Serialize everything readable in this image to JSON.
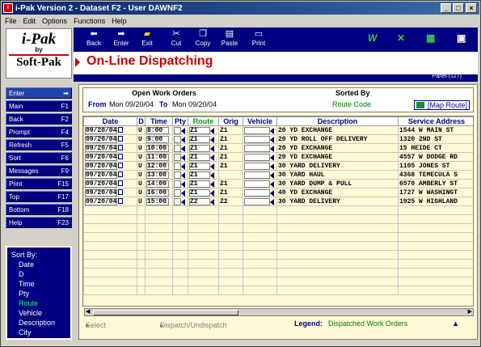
{
  "window": {
    "title": "i-Pak Version 2 - Dataset F2 - User DAWNF2"
  },
  "menu": [
    "File",
    "Edit",
    "Options",
    "Functions",
    "Help"
  ],
  "logo": {
    "brand": "i-Pak",
    "by": "by",
    "company": "Soft-Pak"
  },
  "toolbar": {
    "buttons": [
      {
        "label": "Back",
        "icon": "back-arrow-icon"
      },
      {
        "label": "Enter",
        "icon": "enter-arrow-icon"
      },
      {
        "label": "Exit",
        "icon": "exit-folder-icon"
      },
      {
        "label": "Cut",
        "icon": "scissors-icon"
      },
      {
        "label": "Copy",
        "icon": "copy-icon"
      },
      {
        "label": "Paste",
        "icon": "paste-icon"
      },
      {
        "label": "Print",
        "icon": "printer-icon"
      }
    ],
    "right_icons": [
      "word-icon",
      "excel-icon",
      "calculator-icon",
      "card-icon"
    ]
  },
  "page": {
    "title": "On-Line Dispatching",
    "panel": "Panel (127)"
  },
  "sidebar": [
    {
      "label": "Enter",
      "key": "➡"
    },
    {
      "label": "Main",
      "key": "F1"
    },
    {
      "label": "Back",
      "key": "F2"
    },
    {
      "label": "Prompt",
      "key": "F4"
    },
    {
      "label": "Refresh",
      "key": "F5"
    },
    {
      "label": "Sort",
      "key": "F6"
    },
    {
      "label": "Messages",
      "key": "F9"
    },
    {
      "label": "Print",
      "key": "F15"
    },
    {
      "label": "Top",
      "key": "F17"
    },
    {
      "label": "Bottom",
      "key": "F18"
    },
    {
      "label": "Help",
      "key": "F23"
    }
  ],
  "sort": {
    "heading": "Sort By:",
    "options": [
      "Date",
      "D",
      "Time",
      "Pty",
      "Route",
      "Vehicle",
      "Description",
      "City"
    ],
    "selected": "Route"
  },
  "criteria": {
    "open_label": "Open Work Orders",
    "sorted_label": "Sorted By",
    "from_label": "From",
    "from_value": "Mon 09/20/04",
    "to_label": "To",
    "to_value": "Mon 09/20/04",
    "sorted_value": "Route Code",
    "map_button": "[Map Route]"
  },
  "columns": [
    "Date",
    "D",
    "Time",
    "Pty",
    "Route",
    "Orig",
    "Vehicle",
    "Description",
    "Service Address"
  ],
  "rows": [
    {
      "date": "09/20/04",
      "d": "U",
      "time": "8:00",
      "route": "Z1",
      "orig": "Z1",
      "desc": "20 YD EXCHANGE",
      "addr": "1544 W MAIN ST"
    },
    {
      "date": "09/20/04",
      "d": "U",
      "time": "9:00",
      "route": "Z1",
      "orig": "Z1",
      "desc": "20 YD ROLL OFF DELIVERY",
      "addr": "1320 2ND ST"
    },
    {
      "date": "09/20/04",
      "d": "U",
      "time": "10:00",
      "route": "Z1",
      "orig": "Z1",
      "desc": "20 YD EXCHANGE",
      "addr": "15 HEIDE CT"
    },
    {
      "date": "09/20/04",
      "d": "U",
      "time": "11:00",
      "route": "Z1",
      "orig": "Z1",
      "desc": "20 YD EXCHANGE",
      "addr": "4557 W DODGE RD"
    },
    {
      "date": "09/20/04",
      "d": "U",
      "time": "12:00",
      "route": "Z1",
      "orig": "Z1",
      "desc": "30 YARD DELIVERY",
      "addr": "1105 JONES ST"
    },
    {
      "date": "09/20/04",
      "d": "U",
      "time": "13:00",
      "route": "Z1",
      "orig": "",
      "desc": "30 YARD HAUL",
      "addr": "4368 TEMECULA S"
    },
    {
      "date": "09/20/04",
      "d": "U",
      "time": "14:00",
      "route": "Z1",
      "orig": "Z1",
      "desc": "30 YARD DUMP & PULL",
      "addr": "6570 AMBERLY ST"
    },
    {
      "date": "09/20/04",
      "d": "U",
      "time": "16:00",
      "route": "Z1",
      "orig": "Z1",
      "desc": "40 YD EXCHANGE",
      "addr": "1727 W WASHINGT"
    },
    {
      "date": "09/20/04",
      "d": "U",
      "time": "15:00",
      "route": "Z2",
      "orig": "Z2",
      "desc": "30 YARD DELIVERY",
      "addr": "1925 W HIGHLAND"
    }
  ],
  "footer": {
    "select": "Select",
    "dispatch": "Dispatch/Undispatch",
    "legend_label": "Legend:",
    "legend_value": "Dispatched Work Orders"
  }
}
